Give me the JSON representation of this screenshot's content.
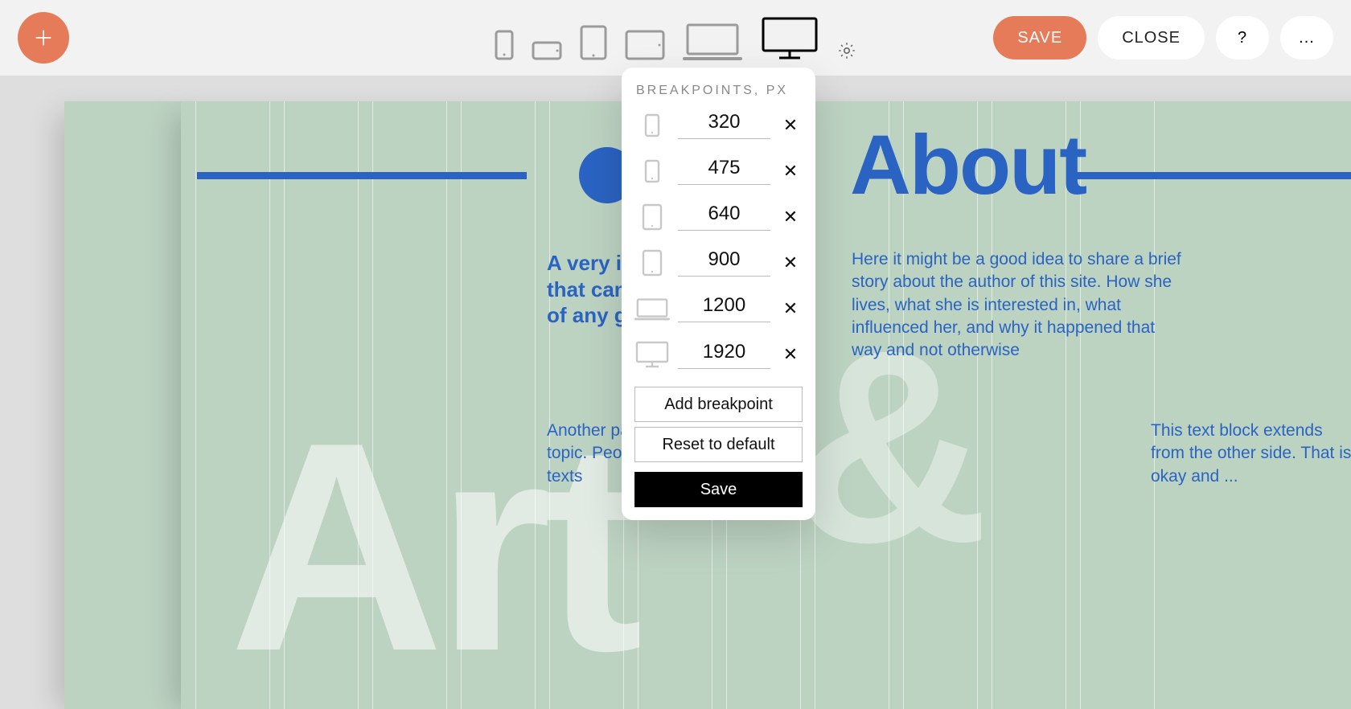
{
  "toolbar": {
    "save_label": "SAVE",
    "close_label": "CLOSE",
    "help_label": "?",
    "more_label": "..."
  },
  "breakpoints_panel": {
    "title": "BREAKPOINTS, PX",
    "rows": [
      {
        "icon": "phone-portrait",
        "value": "320"
      },
      {
        "icon": "phone-portrait",
        "value": "475"
      },
      {
        "icon": "tablet-portrait",
        "value": "640"
      },
      {
        "icon": "tablet-portrait",
        "value": "900"
      },
      {
        "icon": "laptop",
        "value": "1200"
      },
      {
        "icon": "desktop",
        "value": "1920"
      }
    ],
    "add_label": "Add breakpoint",
    "reset_label": "Reset to default",
    "save_label": "Save",
    "delete_glyph": "✕"
  },
  "page_content": {
    "about_heading": "About",
    "big_art": "Art",
    "big_amp": "&",
    "intro": "A very interesting intro that can be the beginning of any general sense",
    "story": "Here it might be a good idea to share a brief story about the author of this site. How she lives, what she is interested in, what influenced her, and why it happened that way and not otherwise",
    "para2": "Another paragraph on the same topic. People usually read short texts",
    "para3": "This text block extends from the other side. That is okay and ..."
  }
}
